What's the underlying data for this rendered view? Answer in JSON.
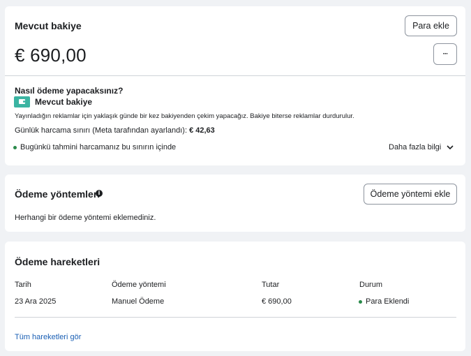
{
  "balance_card": {
    "title": "Mevcut bakiye",
    "add_funds_label": "Para ekle",
    "more_label": "···",
    "amount": "€ 690,00",
    "how_to_pay_title": "Nasıl ödeme yapacaksınız?",
    "method_name": "Mevcut bakiye",
    "description": "Yayınladığın reklamlar için yaklaşık günde bir kez bakiyenden çekim yapacağız. Bakiye biterse reklamlar durdurulur.",
    "daily_limit_label": "Günlük harcama sınırı (Meta tarafından ayarlandı):",
    "daily_limit_value": "€ 42,63",
    "status_text": "Bugünkü tahmini harcamanız bu sınırın içinde",
    "more_info_label": "Daha fazla bilgi",
    "status_color": "#2a8a4a"
  },
  "methods_card": {
    "title": "Ödeme yöntemleri",
    "add_method_label": "Ödeme yöntemi ekle",
    "empty_text": "Herhangi bir ödeme yöntemi eklemediniz."
  },
  "history_card": {
    "title": "Ödeme hareketleri",
    "columns": [
      "Tarih",
      "Ödeme yöntemi",
      "Tutar",
      "Durum"
    ],
    "rows": [
      {
        "date": "23 Ara 2025",
        "method": "Manuel Ödeme",
        "amount": "€ 690,00",
        "status": "Para Eklendi"
      }
    ],
    "view_all_label": "Tüm hareketleri gör"
  }
}
